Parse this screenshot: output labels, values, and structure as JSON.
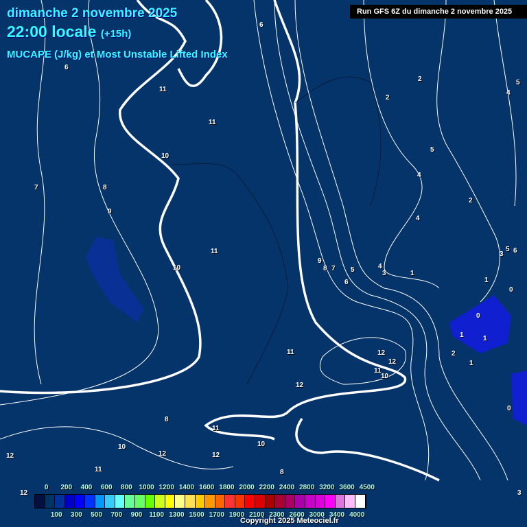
{
  "header": {
    "date": "dimanche 2 novembre 2025",
    "time": "22:00 locale",
    "lead": "(+15h)",
    "title": "MUCAPE (J/kg) et Most Unstable Lifted Index",
    "run": "Run GFS 6Z du dimanche 2 novembre 2025"
  },
  "legend": {
    "top_ticks": [
      "0",
      "200",
      "400",
      "600",
      "800",
      "1000",
      "1200",
      "1400",
      "1600",
      "1800",
      "2000",
      "2200",
      "2400",
      "2800",
      "3200",
      "3600",
      "4500"
    ],
    "bottom_ticks": [
      "100",
      "300",
      "500",
      "700",
      "900",
      "1100",
      "1300",
      "1500",
      "1700",
      "1900",
      "2100",
      "2300",
      "2600",
      "3000",
      "3400",
      "4000"
    ],
    "colors": [
      "#001040",
      "#003366",
      "#003399",
      "#0000cc",
      "#0000ff",
      "#0033ff",
      "#0099ff",
      "#33ccff",
      "#66ffff",
      "#66ff99",
      "#66ff66",
      "#66ff00",
      "#ccff1a",
      "#ffff00",
      "#ffff88",
      "#ffe050",
      "#ffcc00",
      "#ff9900",
      "#ff6600",
      "#ff3333",
      "#ff3300",
      "#ff0000",
      "#dd0000",
      "#aa0000",
      "#aa0033",
      "#aa0066",
      "#aa00aa",
      "#cc00cc",
      "#dd00dd",
      "#ff00ff",
      "#dd77dd",
      "#ffbbff",
      "#ffffff"
    ]
  },
  "contour_labels": [
    "6",
    "6",
    "11",
    "11",
    "10",
    "7",
    "8",
    "9",
    "10",
    "11",
    "2",
    "2",
    "5",
    "4",
    "2",
    "4",
    "5",
    "4",
    "6",
    "5",
    "3",
    "1",
    "0",
    "9",
    "8",
    "7",
    "5",
    "6",
    "4",
    "3",
    "1",
    "0",
    "1",
    "1",
    "2",
    "1",
    "12",
    "12",
    "11",
    "10",
    "11",
    "12",
    "8",
    "11",
    "10",
    "10",
    "12",
    "12",
    "11",
    "8",
    "12",
    "12",
    "0",
    "3"
  ],
  "copyright": "Copyright 2025 Meteociel.fr"
}
